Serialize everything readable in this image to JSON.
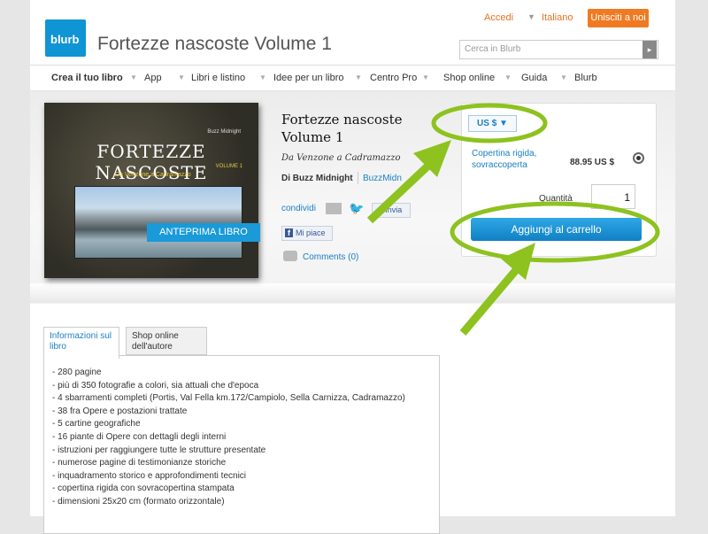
{
  "header": {
    "logo": "blurb",
    "title": "Fortezze nascoste Volume 1",
    "login": "Accedi",
    "language": "Italiano",
    "join": "Unisciti a noi",
    "search_placeholder": "Cerca in Blurb",
    "search_btn": "▸"
  },
  "nav": [
    "Crea il tuo libro",
    "App",
    "Libri e listino",
    "Idee per un libro",
    "Centro Pro",
    "Shop online",
    "Guida",
    "Blurb"
  ],
  "book": {
    "cover_author": "Buzz Midnight",
    "cover_title": "FORTEZZE NASCOSTE",
    "cover_volume": "VOLUME 1",
    "cover_subtitle": "Da Venzone a Cadramazzo",
    "preview": "ANTEPRIMA LIBRO",
    "title_line1": "Fortezze nascoste",
    "title_line2": "Volume 1",
    "subtitle": "Da Venzone a Cadramazzo",
    "by": "Di Buzz Midnight",
    "by_link": "BuzzMidn",
    "share": "condividi",
    "send": "Invia",
    "like": "Mi piace",
    "comments": "Comments (0)"
  },
  "buy": {
    "currency": "US $ ▼",
    "option_line1": "Copertina rigida,",
    "option_line2": "sovraccoperta",
    "price": "88.95 US $",
    "qty_label": "Quantità",
    "qty": "1",
    "add_to_cart": "Aggiungi al carrello"
  },
  "tabs": {
    "info_line1": "Informazioni sul",
    "info_line2": "libro",
    "shop_line1": "Shop online",
    "shop_line2": "dell'autore"
  },
  "details": [
    "- 280 pagine",
    "- più di 350 fotografie a colori, sia attuali che d'epoca",
    "- 4 sbarramenti completi (Portis, Val Fella km.172/Campiolo, Sella Carnizza, Cadramazzo)",
    "- 38 fra Opere e postazioni trattate",
    "- 5 cartine geografiche",
    "- 16 piante di Opere con dettagli degli interni",
    "- istruzioni per raggiungere tutte le strutture presentate",
    "- numerose pagine di testimonianze storiche",
    "- inquadramento storico e approfondimenti tecnici",
    "- copertina rigida con sovracopertina stampata",
    "- dimensioni 25x20 cm (formato orizzontale)"
  ],
  "colors": {
    "accent": "#1a9ad8",
    "orange": "#f07a22",
    "annotation": "#8dc21f"
  }
}
